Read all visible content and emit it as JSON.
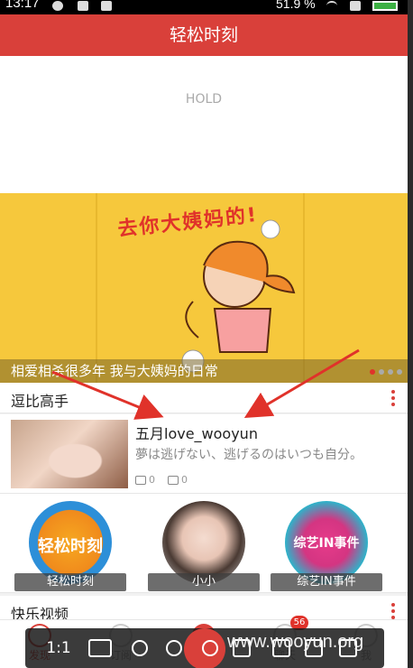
{
  "status": {
    "time": "13:17",
    "battery_text": "51.9 %"
  },
  "header": {
    "title": "轻松时刻"
  },
  "hold": {
    "text": "HOLD"
  },
  "banner": {
    "art_text": "去你大姨妈的!",
    "caption": "相爱相杀很多年 我与大姨妈的日常",
    "page_count": 4,
    "active_index": 0
  },
  "section1": {
    "label": "逗比高手"
  },
  "featured": {
    "name": "五月love_wooyun",
    "desc": "夢は逃げない、逃げるのはいつも自分。",
    "reads": "0",
    "comments": "0"
  },
  "circles": [
    {
      "label": "轻松时刻",
      "art": "轻松时刻"
    },
    {
      "label": "小小",
      "art": ""
    },
    {
      "label": "综艺IN事件",
      "art": "综艺IN事件"
    }
  ],
  "section2": {
    "label": "快乐视频"
  },
  "nav": {
    "items": [
      {
        "label": "发现"
      },
      {
        "label": "订阅"
      },
      {
        "label": ""
      },
      {
        "label": "聊天"
      },
      {
        "label": "我"
      }
    ],
    "badge": "56"
  },
  "viewer": {
    "zoom": "1:1"
  },
  "watermark": "www.wooyun.org",
  "colors": {
    "accent": "#d9403a",
    "banner_bg": "#f6c83c"
  }
}
